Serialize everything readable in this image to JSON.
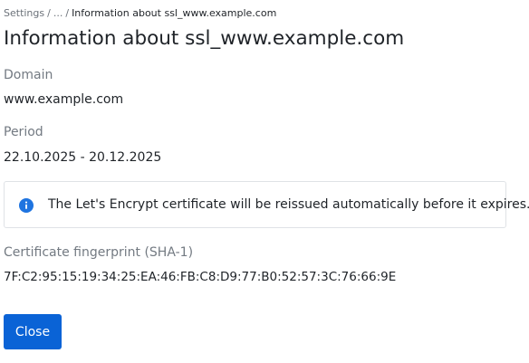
{
  "breadcrumb": {
    "items": [
      {
        "label": "Settings"
      },
      {
        "label": "..."
      },
      {
        "label": "Information about ssl_www.example.com"
      }
    ],
    "separator": "/"
  },
  "page_title": "Information about ssl_www.example.com",
  "fields": {
    "domain": {
      "label": "Domain",
      "value": "www.example.com"
    },
    "period": {
      "label": "Period",
      "value": "22.10.2025 - 20.12.2025"
    },
    "fingerprint": {
      "label": "Certificate fingerprint (SHA-1)",
      "value": "7F:C2:95:15:19:34:25:EA:46:FB:C8:D9:77:B0:52:57:3C:76:66:9E"
    }
  },
  "info_message": {
    "icon": "info-circle-icon",
    "text": "The Let's Encrypt certificate will be reissued automatically before it expires."
  },
  "actions": {
    "close_label": "Close"
  },
  "colors": {
    "accent": "#0a63d6",
    "text": "#1f2328",
    "muted": "#737a82",
    "border": "#dfe2e6"
  }
}
